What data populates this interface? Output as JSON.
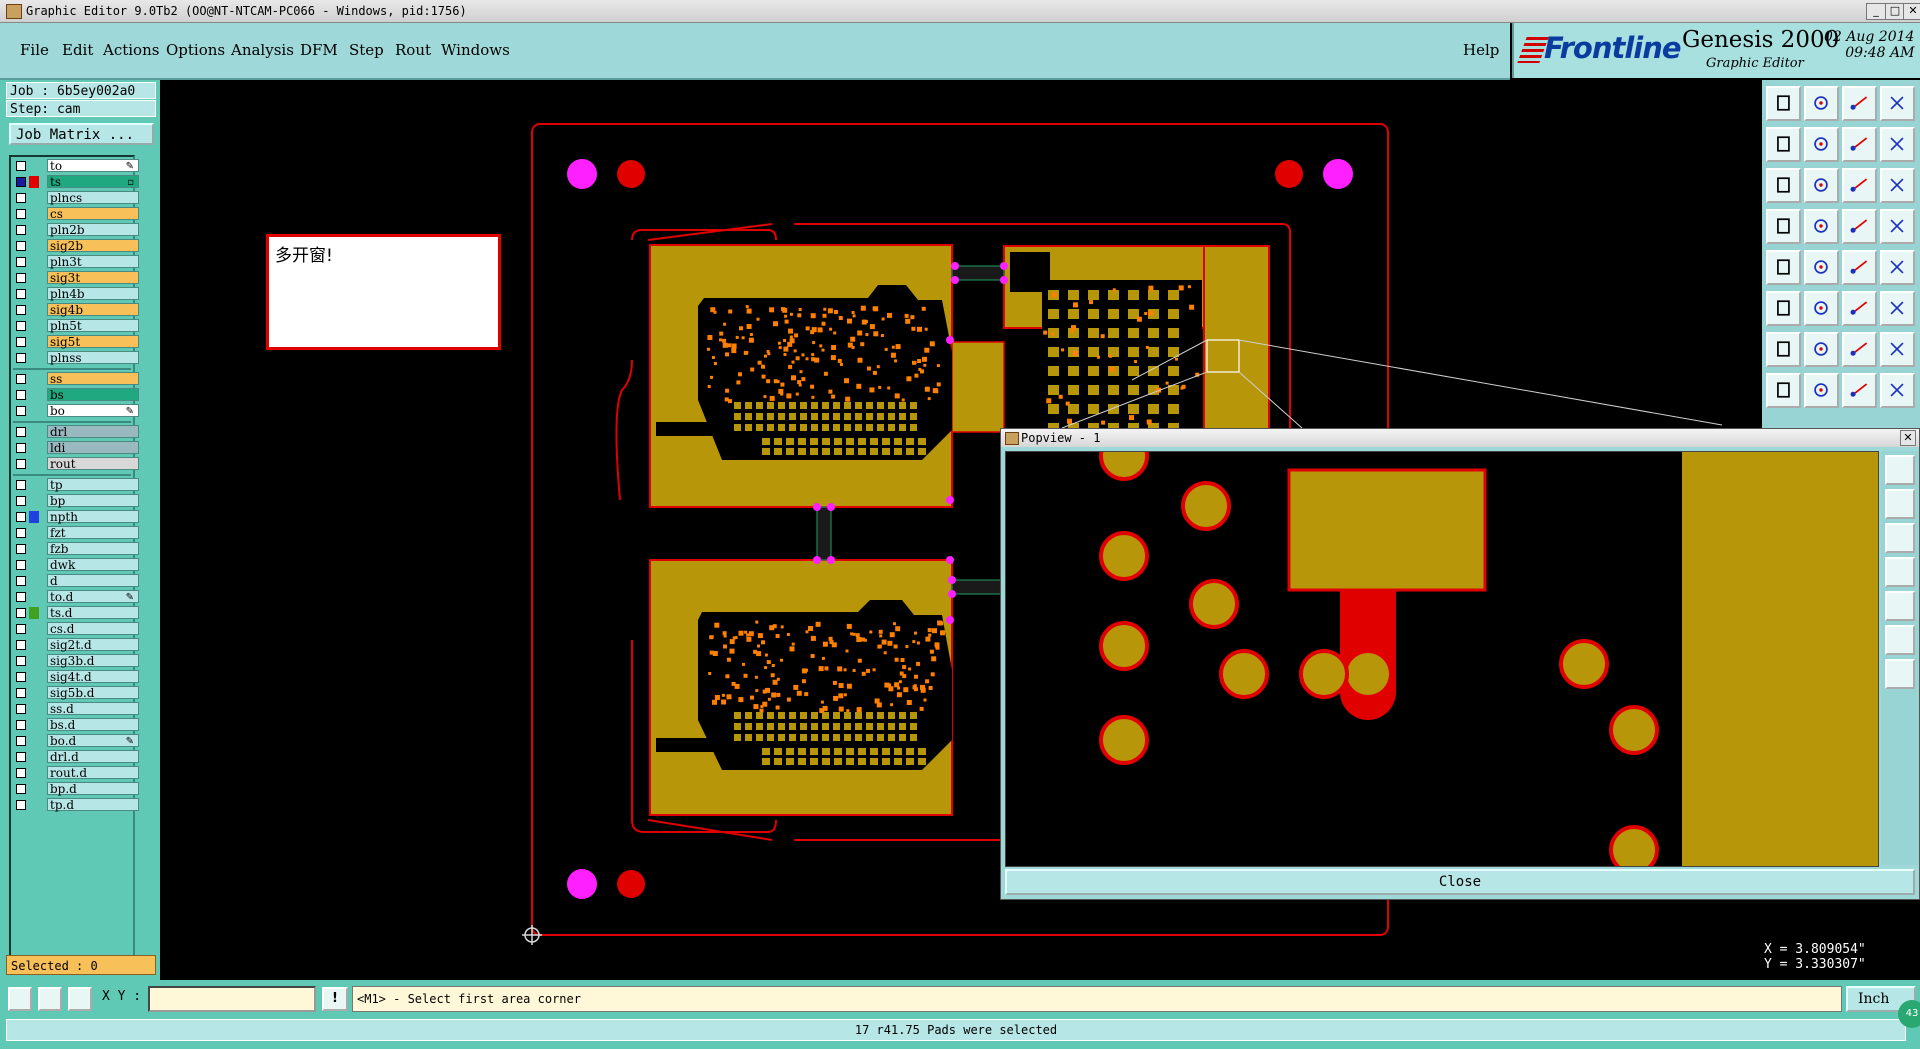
{
  "window": {
    "title": "Graphic Editor 9.0Tb2 (OO@NT-NTCAM-PC066 - Windows, pid:1756)",
    "minimize": "_",
    "maximize": "□",
    "close": "✕"
  },
  "menu": {
    "items": [
      "File",
      "Edit",
      "Actions",
      "Options",
      "Analysis",
      "DFM",
      "Step",
      "Rout",
      "Windows"
    ],
    "help": "Help"
  },
  "brand": {
    "logo": "Frontline",
    "product": "Genesis 2000",
    "subtitle": "Graphic Editor",
    "date": "02 Aug 2014",
    "time": "09:48 AM"
  },
  "job": {
    "job_line": "Job : 6b5ey002a0",
    "step_line": "Step: cam",
    "matrix_button": "Job Matrix ..."
  },
  "layers": [
    {
      "name": "to",
      "color": "#ffffff",
      "checked": false,
      "swatch": "",
      "mark": "✎"
    },
    {
      "name": "ts",
      "color": "#20a880",
      "checked": true,
      "swatch": "#e00000",
      "mark": "▫"
    },
    {
      "name": "plncs",
      "color": "#b6e6e6",
      "checked": false,
      "swatch": "",
      "mark": ""
    },
    {
      "name": "cs",
      "color": "#f8c058",
      "checked": false,
      "swatch": "",
      "mark": ""
    },
    {
      "name": "pln2b",
      "color": "#b6e6e6",
      "checked": false,
      "swatch": "",
      "mark": ""
    },
    {
      "name": "sig2b",
      "color": "#f8c058",
      "checked": false,
      "swatch": "",
      "mark": ""
    },
    {
      "name": "pln3t",
      "color": "#b6e6e6",
      "checked": false,
      "swatch": "",
      "mark": ""
    },
    {
      "name": "sig3t",
      "color": "#f8c058",
      "checked": false,
      "swatch": "",
      "mark": ""
    },
    {
      "name": "pln4b",
      "color": "#b6e6e6",
      "checked": false,
      "swatch": "",
      "mark": ""
    },
    {
      "name": "sig4b",
      "color": "#f8c058",
      "checked": false,
      "swatch": "",
      "mark": ""
    },
    {
      "name": "pln5t",
      "color": "#b6e6e6",
      "checked": false,
      "swatch": "",
      "mark": ""
    },
    {
      "name": "sig5t",
      "color": "#f8c058",
      "checked": false,
      "swatch": "",
      "mark": ""
    },
    {
      "name": "plnss",
      "color": "#b6e6e6",
      "checked": false,
      "swatch": "",
      "mark": ""
    },
    {
      "name": "ss",
      "color": "#f8c058",
      "checked": false,
      "swatch": "",
      "mark": ""
    },
    {
      "name": "bs",
      "color": "#20a880",
      "checked": false,
      "swatch": "",
      "mark": ""
    },
    {
      "name": "bo",
      "color": "#ffffff",
      "checked": false,
      "swatch": "",
      "mark": "✎"
    },
    {
      "name": "drl",
      "color": "#9ab8c0",
      "checked": false,
      "swatch": "",
      "mark": ""
    },
    {
      "name": "ldi",
      "color": "#9ab8c0",
      "checked": false,
      "swatch": "",
      "mark": ""
    },
    {
      "name": "rout",
      "color": "#d8d8d8",
      "checked": false,
      "swatch": "",
      "mark": ""
    },
    {
      "name": "tp",
      "color": "#b6e6e6",
      "checked": false,
      "swatch": "",
      "mark": ""
    },
    {
      "name": "bp",
      "color": "#b6e6e6",
      "checked": false,
      "swatch": "",
      "mark": ""
    },
    {
      "name": "npth",
      "color": "#b6e6e6",
      "checked": false,
      "swatch": "#2040e0",
      "mark": ""
    },
    {
      "name": "fzt",
      "color": "#b6e6e6",
      "checked": false,
      "swatch": "",
      "mark": ""
    },
    {
      "name": "fzb",
      "color": "#b6e6e6",
      "checked": false,
      "swatch": "",
      "mark": ""
    },
    {
      "name": "dwk",
      "color": "#b6e6e6",
      "checked": false,
      "swatch": "",
      "mark": ""
    },
    {
      "name": "d",
      "color": "#b6e6e6",
      "checked": false,
      "swatch": "",
      "mark": ""
    },
    {
      "name": "to.d",
      "color": "#b6e6e6",
      "checked": false,
      "swatch": "",
      "mark": "✎"
    },
    {
      "name": "ts.d",
      "color": "#b6e6e6",
      "checked": false,
      "swatch": "#40a020",
      "mark": ""
    },
    {
      "name": "cs.d",
      "color": "#b6e6e6",
      "checked": false,
      "swatch": "",
      "mark": ""
    },
    {
      "name": "sig2t.d",
      "color": "#b6e6e6",
      "checked": false,
      "swatch": "",
      "mark": ""
    },
    {
      "name": "sig3b.d",
      "color": "#b6e6e6",
      "checked": false,
      "swatch": "",
      "mark": ""
    },
    {
      "name": "sig4t.d",
      "color": "#b6e6e6",
      "checked": false,
      "swatch": "",
      "mark": ""
    },
    {
      "name": "sig5b.d",
      "color": "#b6e6e6",
      "checked": false,
      "swatch": "",
      "mark": ""
    },
    {
      "name": "ss.d",
      "color": "#b6e6e6",
      "checked": false,
      "swatch": "",
      "mark": ""
    },
    {
      "name": "bs.d",
      "color": "#b6e6e6",
      "checked": false,
      "swatch": "",
      "mark": ""
    },
    {
      "name": "bo.d",
      "color": "#b6e6e6",
      "checked": false,
      "swatch": "",
      "mark": "✎"
    },
    {
      "name": "drl.d",
      "color": "#b6e6e6",
      "checked": false,
      "swatch": "",
      "mark": ""
    },
    {
      "name": "rout.d",
      "color": "#b6e6e6",
      "checked": false,
      "swatch": "",
      "mark": ""
    },
    {
      "name": "bp.d",
      "color": "#b6e6e6",
      "checked": false,
      "swatch": "",
      "mark": ""
    },
    {
      "name": "tp.d",
      "color": "#b6e6e6",
      "checked": false,
      "swatch": "",
      "mark": ""
    }
  ],
  "selected": "Selected : 0",
  "note": "多开窗!",
  "coords": {
    "x": "X = 3.809054\"",
    "y": "Y = 3.330307\""
  },
  "popview": {
    "title": "Popview - 1",
    "close": "Close",
    "close_x": "✕"
  },
  "bottom": {
    "xy_label": "X Y :",
    "xy_value": "",
    "warn": "!",
    "prompt": "<M1> - Select first area corner",
    "units": "Inch",
    "status": "17 r41.75 Pads were selected",
    "zoom": "43"
  },
  "colors": {
    "copper": "#b8960a",
    "mask": "#e00000",
    "pad": "#ff8000",
    "npth": "#ff20ff",
    "panel": "#5fc9b5",
    "menubar": "#9fd8d8"
  },
  "icons": [
    "undo-icon",
    "redo-icon",
    "home-icon",
    "layout-icon",
    "move-left-icon",
    "move-right-icon",
    "flip-icon",
    "mirror-icon",
    "zoom-fit-icon",
    "pan-icon",
    "scale-icon",
    "query-icon",
    "measure-icon",
    "grid-icon",
    "snap-icon",
    "highlight-icon",
    "select-icon",
    "area-icon",
    "line-icon",
    "polygon-icon",
    "net-icon",
    "cross-icon",
    "connect-icon",
    "route-icon",
    "arc-icon",
    "slash-icon",
    "rotate-icon",
    "split-icon",
    "pad-icon",
    "trace-icon",
    "dimension-icon",
    "copy-icon"
  ]
}
